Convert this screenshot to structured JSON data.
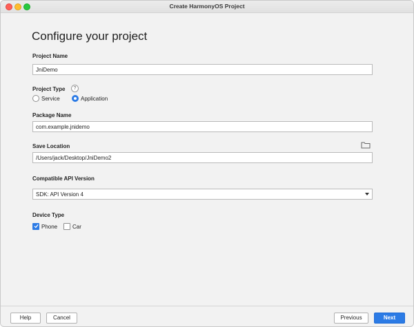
{
  "window": {
    "title": "Create HarmonyOS Project"
  },
  "page": {
    "heading": "Configure your project"
  },
  "project_name": {
    "label": "Project Name",
    "value": "JniDemo"
  },
  "project_type": {
    "label": "Project Type",
    "help": "?",
    "options": [
      {
        "label": "Service",
        "selected": false
      },
      {
        "label": "Application",
        "selected": true
      }
    ]
  },
  "package_name": {
    "label": "Package Name",
    "value": "com.example.jnidemo"
  },
  "save_location": {
    "label": "Save Location",
    "value": "/Users/jack/Desktop/JniDemo2",
    "icon": "folder-icon"
  },
  "api_version": {
    "label": "Compatible API Version",
    "selected": "SDK: API Version 4"
  },
  "device_type": {
    "label": "Device Type",
    "options": [
      {
        "label": "Phone",
        "checked": true
      },
      {
        "label": "Car",
        "checked": false
      }
    ]
  },
  "footer": {
    "help": "Help",
    "cancel": "Cancel",
    "previous": "Previous",
    "next": "Next"
  },
  "colors": {
    "accent": "#2c7be5",
    "background": "#f2f2f2"
  }
}
